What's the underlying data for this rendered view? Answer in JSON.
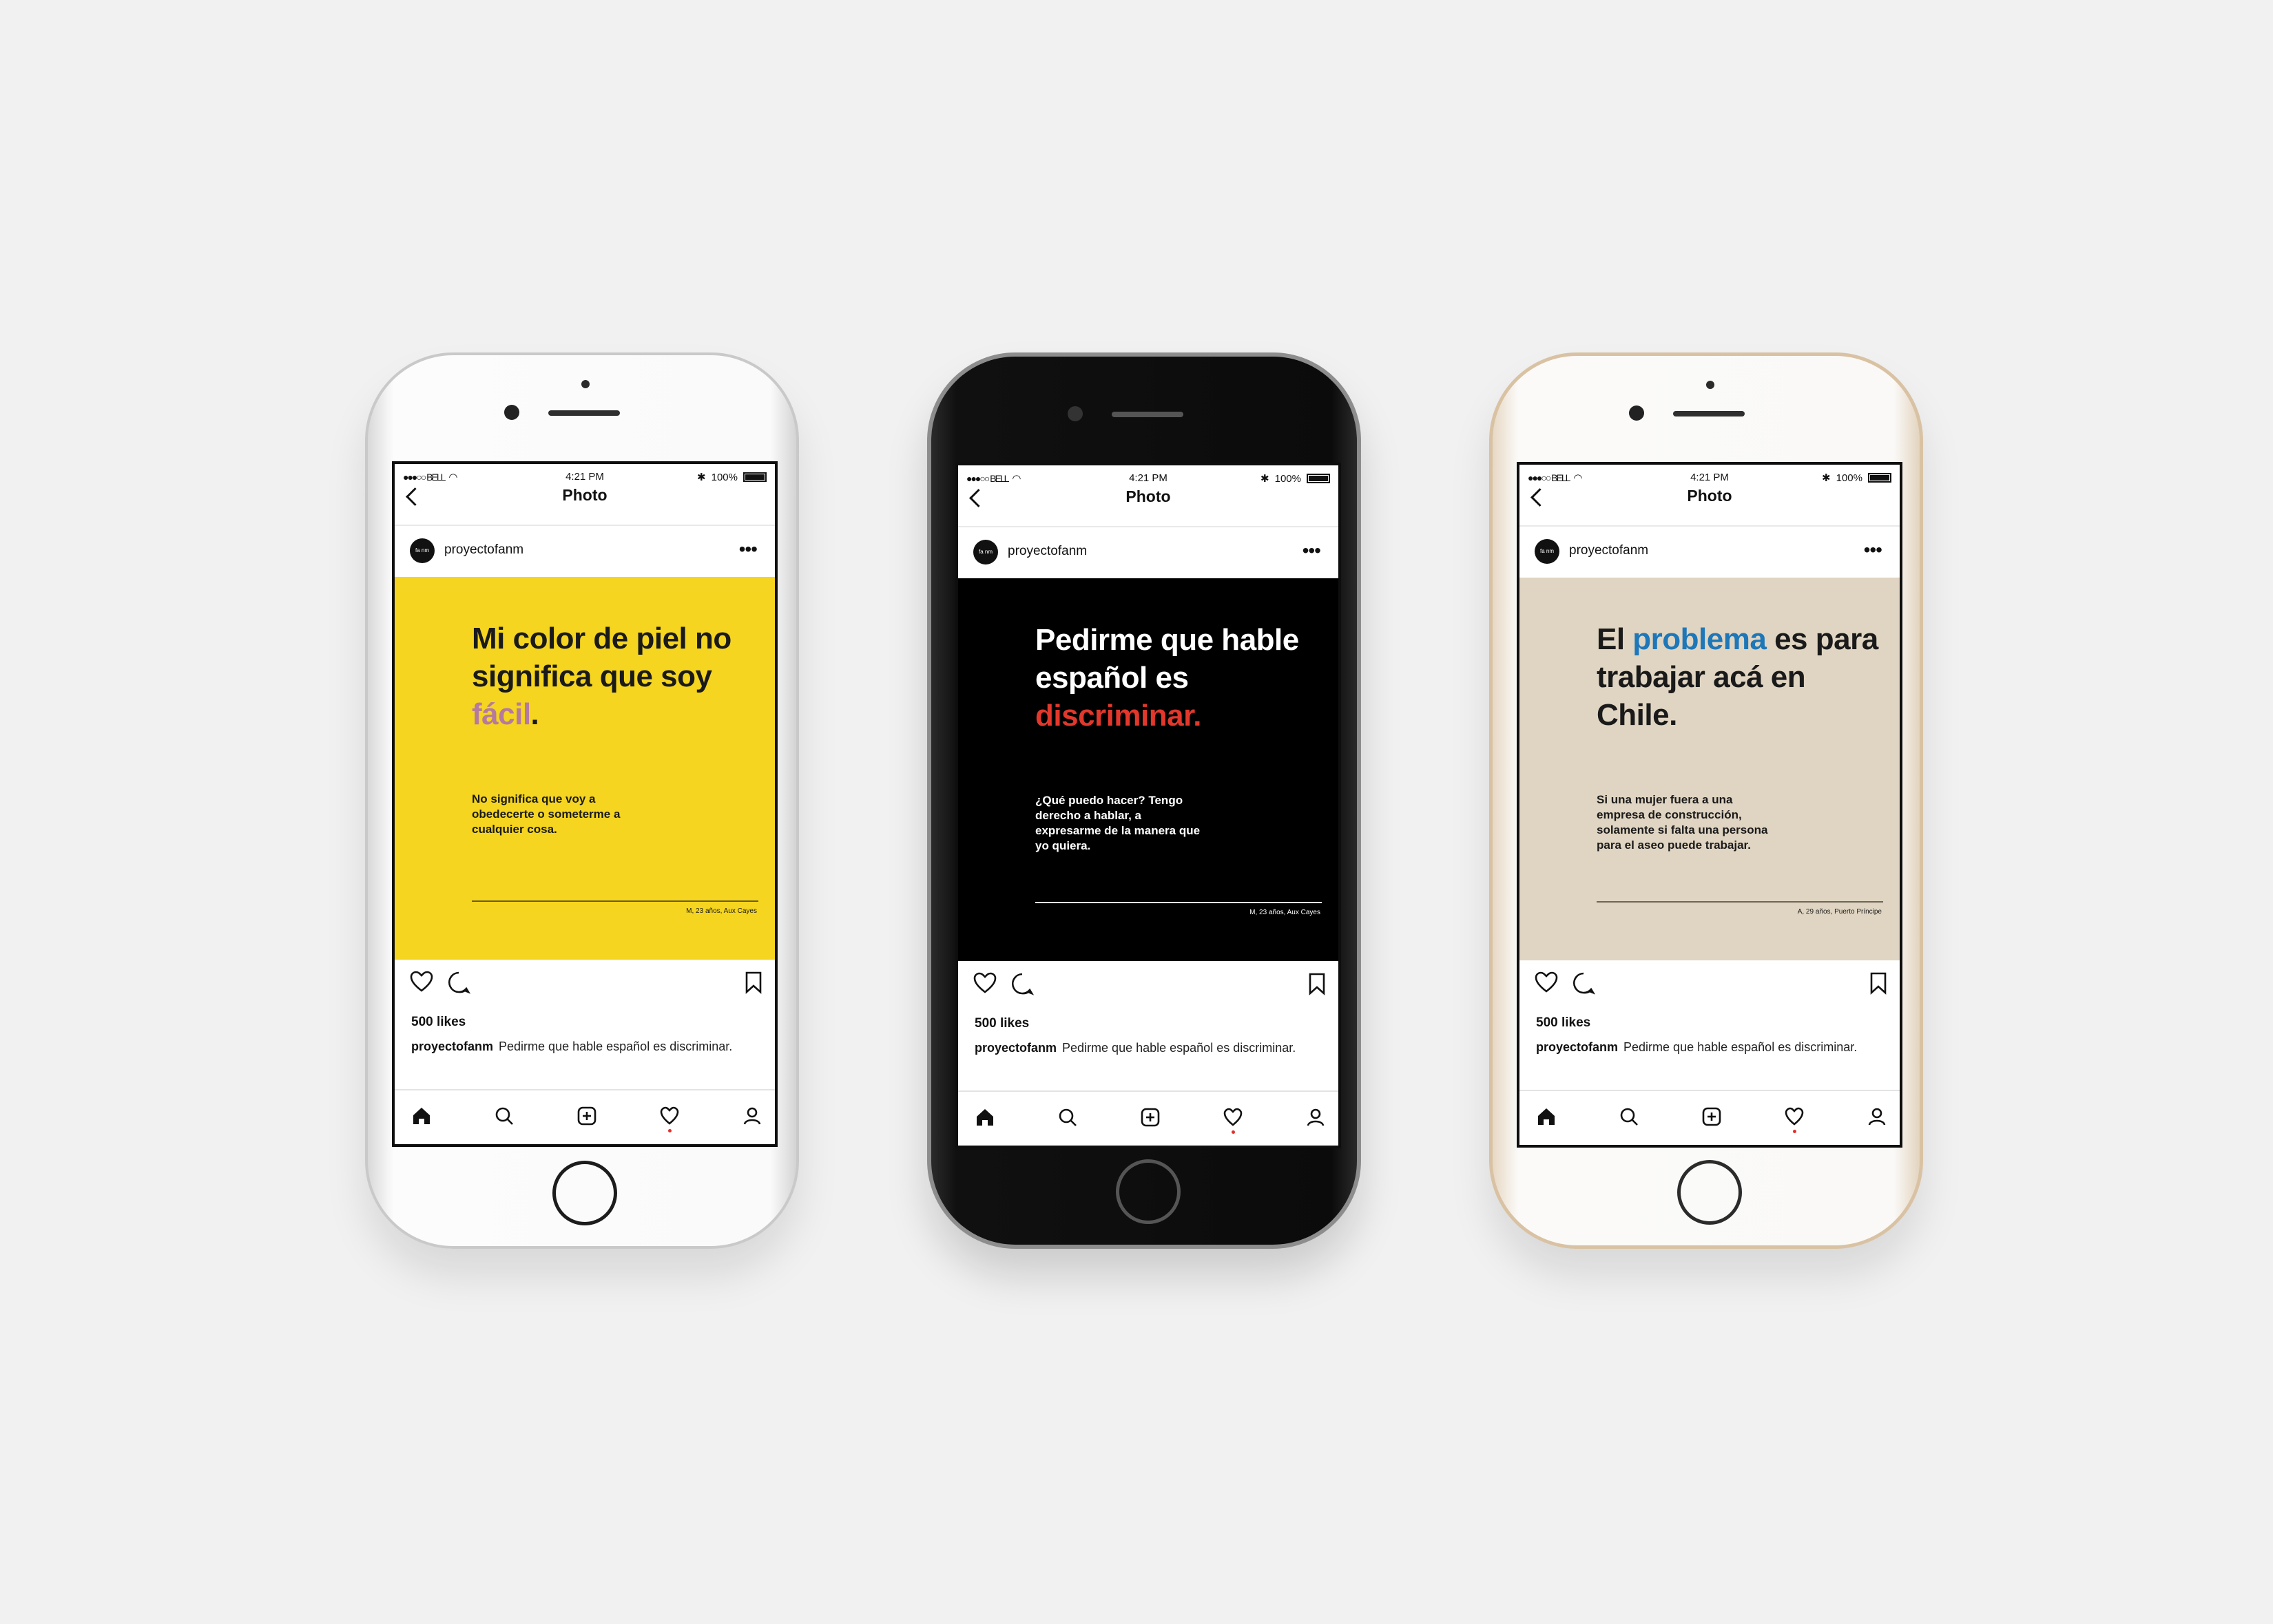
{
  "phones": [
    {
      "status": {
        "carrier": "●●●○○ BELL",
        "time": "4:21 PM",
        "battery": "100%"
      },
      "nav_title": "Photo",
      "username": "proyectofanm",
      "avatar_text": "fa nm",
      "post": {
        "bg_color": "#f5d51f",
        "text_color": "#1a1a1a",
        "accent_color": "#b47aa0",
        "headline": "Mi color de piel no significa que soy ",
        "headline_accent": "fácil",
        "headline_end": ".",
        "body": "No significa que voy a obedecerte o someterme a cualquier cosa.",
        "credit": "M, 23 años, Aux Cayes"
      },
      "likes": "500 likes",
      "caption_user": "proyectofanm",
      "caption_text": "Pedirme que hable español es discriminar."
    },
    {
      "status": {
        "carrier": "●●●○○ BELL",
        "time": "4:21 PM",
        "battery": "100%"
      },
      "nav_title": "Photo",
      "username": "proyectofanm",
      "avatar_text": "fa nm",
      "post": {
        "bg_color": "#000000",
        "text_color": "#ffffff",
        "accent_color": "#e2382c",
        "headline": "Pedirme que hable español es ",
        "headline_accent": "discriminar.",
        "headline_end": "",
        "body": "¿Qué puedo hacer? Tengo derecho a hablar, a expresarme de la manera que yo quiera.",
        "credit": "M, 23 años, Aux Cayes"
      },
      "likes": "500 likes",
      "caption_user": "proyectofanm",
      "caption_text": "Pedirme que hable español es discriminar."
    },
    {
      "status": {
        "carrier": "●●●○○ BELL",
        "time": "4:21 PM",
        "battery": "100%"
      },
      "nav_title": "Photo",
      "username": "proyectofanm",
      "avatar_text": "fa nm",
      "post": {
        "bg_color": "#e0d5c2",
        "text_color": "#1a1a1a",
        "accent_color": "#1d77b8",
        "headline": "El ",
        "headline_accent": "problema",
        "headline_end": " es para trabajar acá en Chile.",
        "body": "Si una mujer fuera a una empresa de construcción, solamente si falta una persona para el aseo puede trabajar.",
        "credit": "A, 29 años, Puerto Príncipe"
      },
      "likes": "500 likes",
      "caption_user": "proyectofanm",
      "caption_text": "Pedirme que hable español es discriminar."
    }
  ]
}
